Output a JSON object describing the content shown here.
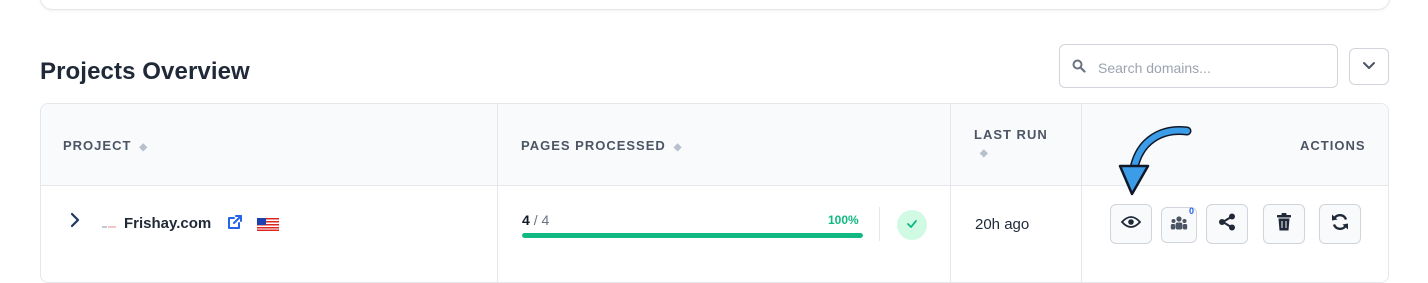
{
  "page": {
    "title": "Projects Overview"
  },
  "search": {
    "placeholder": "Search domains..."
  },
  "table": {
    "headers": {
      "project": "PROJECT",
      "pages_processed": "PAGES PROCESSED",
      "last_run": "LAST RUN",
      "actions": "ACTIONS"
    },
    "sort_glyph": "◆",
    "rows": [
      {
        "name": "Frishay.com",
        "pages_done": "4",
        "pages_total": "/ 4",
        "progress_label": "100%",
        "progress": 1.0,
        "status": "complete",
        "last_run": "20h ago",
        "collaborators_count": "0"
      }
    ]
  },
  "colors": {
    "accent": "#10b981",
    "link": "#2563eb",
    "arrow": "#3b9ce8"
  }
}
